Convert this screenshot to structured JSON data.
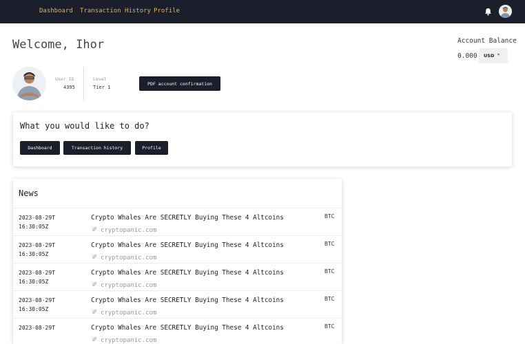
{
  "nav": {
    "links": [
      "Dashboard",
      "Transaction History",
      "Profile"
    ],
    "accent_color": "#e5b33f",
    "bar_color": "#1b1e2b",
    "bell_icon": "bell-icon",
    "avatar_icon": "user-avatar"
  },
  "welcome": {
    "title": "Welcome, Ihor"
  },
  "balance": {
    "title": "Account Balance",
    "value": "0.000",
    "currency": "USD",
    "caret": "▾"
  },
  "profile": {
    "user_id_label": "User ID",
    "user_id": "4395",
    "level_label": "Level",
    "level": "Tier 1",
    "pdf_button": "PDF account confirmation"
  },
  "actions": {
    "title": "What you would like to do?",
    "buttons": [
      "Dashboard",
      "Transaction history",
      "Profile"
    ]
  },
  "news": {
    "title": "News",
    "items": [
      {
        "date": "2023-08-29T 16:30:05Z",
        "title": "Crypto Whales Are SECRETLY Buying These 4 Altcoins",
        "source": "cryptopanic.com",
        "currency": "BTC"
      },
      {
        "date": "2023-08-29T 16:30:05Z",
        "title": "Crypto Whales Are SECRETLY Buying These 4 Altcoins",
        "source": "cryptopanic.com",
        "currency": "BTC"
      },
      {
        "date": "2023-08-29T 16:30:05Z",
        "title": "Crypto Whales Are SECRETLY Buying These 4 Altcoins",
        "source": "cryptopanic.com",
        "currency": "BTC"
      },
      {
        "date": "2023-08-29T 16:30:05Z",
        "title": "Crypto Whales Are SECRETLY Buying These 4 Altcoins",
        "source": "cryptopanic.com",
        "currency": "BTC"
      },
      {
        "date": "2023-08-29T",
        "title": "Crypto Whales Are SECRETLY Buying These 4 Altcoins",
        "source": "cryptopanic.com",
        "currency": "BTC"
      }
    ]
  }
}
